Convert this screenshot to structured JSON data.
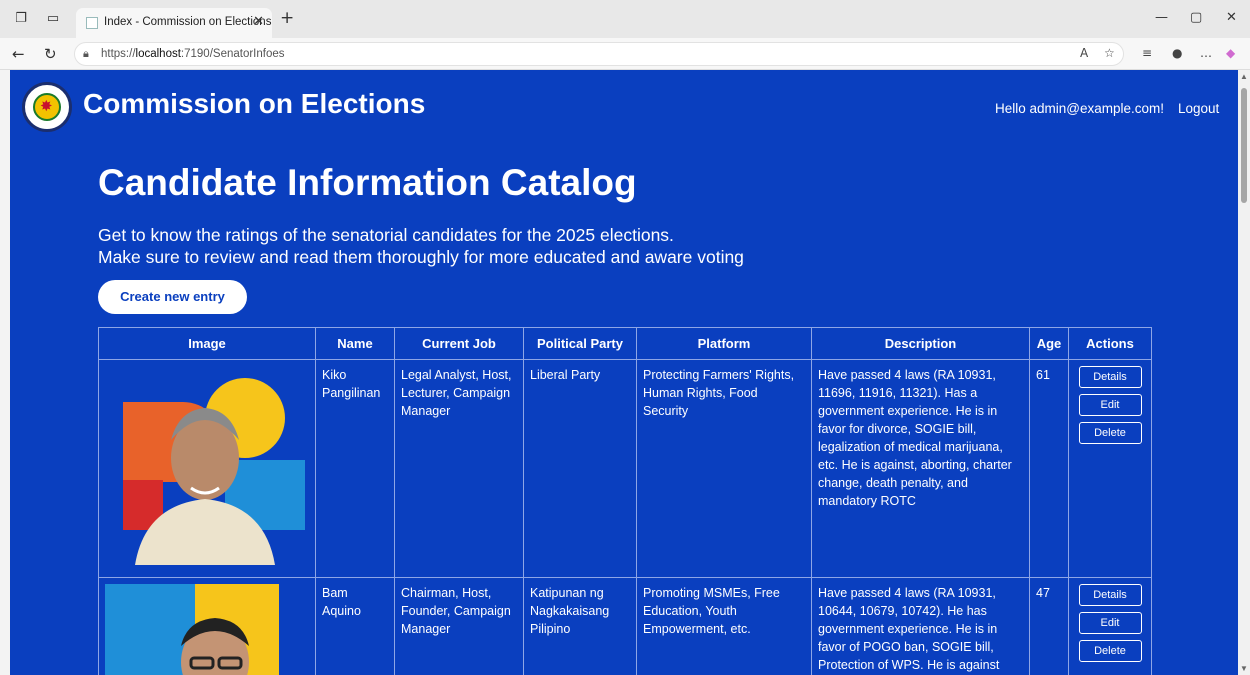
{
  "browser": {
    "tab_title": "Index - Commission on Elections",
    "url_prefix": "https://",
    "url_host": "localhost",
    "url_rest": ":7190/SenatorInfoes"
  },
  "header": {
    "brand": "Commission on Elections",
    "greeting": "Hello admin@example.com!",
    "logout": "Logout"
  },
  "main": {
    "title": "Candidate Information Catalog",
    "subtitle_line1": "Get to know the ratings of the senatorial candidates for the 2025 elections.",
    "subtitle_line2": "Make sure to review and read them thoroughly for more educated and aware voting",
    "create_button": "Create new entry"
  },
  "table": {
    "headers": [
      "Image",
      "Name",
      "Current Job",
      "Political Party",
      "Platform",
      "Description",
      "Age",
      "Actions"
    ],
    "actions": [
      "Details",
      "Edit",
      "Delete"
    ],
    "rows": [
      {
        "name": "Kiko Pangilinan",
        "job": "Legal Analyst, Host, Lecturer, Campaign Manager",
        "party": "Liberal Party",
        "platform": "Protecting Farmers' Rights, Human Rights, Food Security",
        "description": "Have passed 4 laws (RA 10931, 11696, 11916, 11321). Has a government experience. He is in favor for divorce, SOGIE bill, legalization of medical marijuana, etc. He is against, aborting, charter change, death penalty, and mandatory ROTC",
        "age": "61"
      },
      {
        "name": "Bam Aquino",
        "job": "Chairman, Host, Founder, Campaign Manager",
        "party": "Katipunan ng Nagkakaisang Pilipino",
        "platform": "Promoting MSMEs, Free Education, Youth Empowerment, etc.",
        "description": "Have passed 4 laws (RA 10931, 10644, 10679, 10742). He has government experience. He is in favor of POGO ban, SOGIE bill, Protection of WPS. He is against",
        "age": "47"
      }
    ]
  },
  "colors": {
    "page_bg": "#0a3fbf",
    "button_bg": "#ffffff",
    "text": "#ffffff"
  }
}
